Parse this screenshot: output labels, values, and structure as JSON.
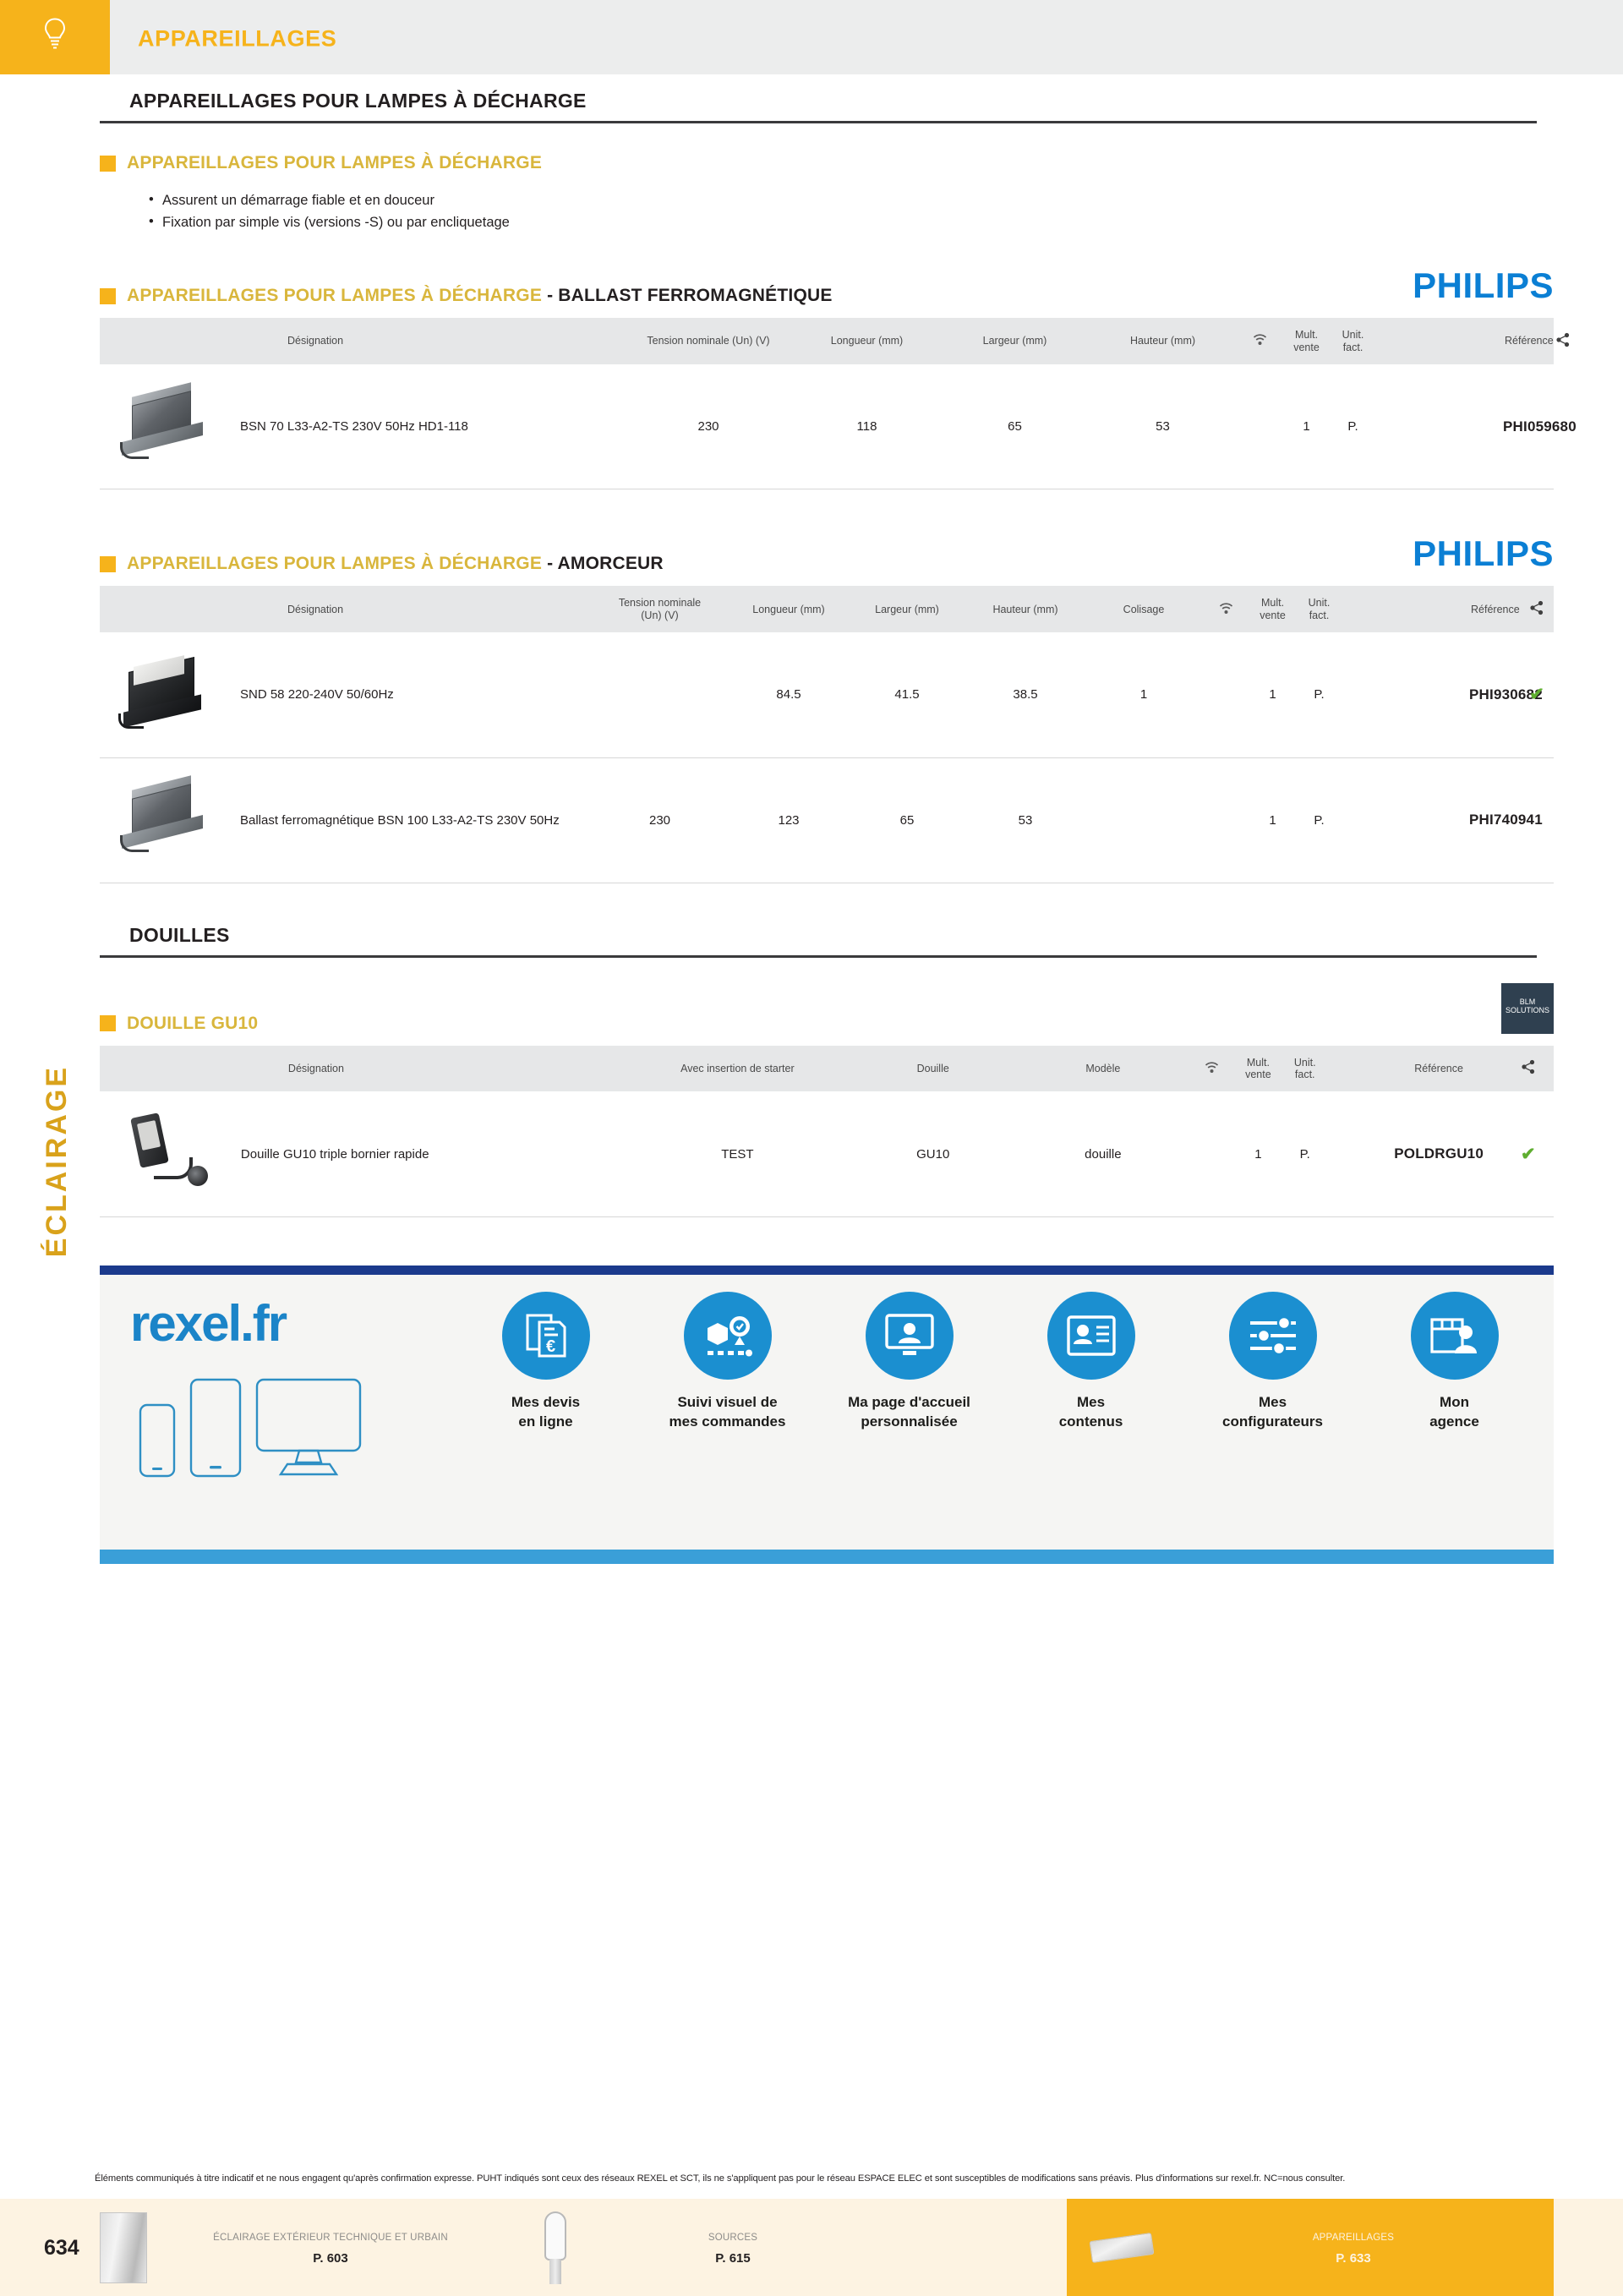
{
  "topbar": {
    "category": "APPAREILLAGES",
    "icon": "bulb-icon"
  },
  "rail_label": "ÉCLAIRAGE",
  "page_heading": "APPAREILLAGES POUR LAMPES À DÉCHARGE",
  "intro": {
    "title": "APPAREILLAGES POUR LAMPES À DÉCHARGE",
    "bullets": [
      "Assurent un démarrage fiable et en douceur",
      "Fixation par simple vis (versions -S) ou par encliquetage"
    ]
  },
  "sections": [
    {
      "title_yellow": "APPAREILLAGES POUR LAMPES À DÉCHARGE",
      "title_dark": " - BALLAST FERROMAGNÉTIQUE",
      "brand": "PHILIPS",
      "brand_type": "philips",
      "columns": [
        "Désignation",
        "Tension nominale (Un) (V)",
        "Longueur (mm)",
        "Largeur (mm)",
        "Hauteur (mm)",
        "wifi-icon",
        "Mult. vente",
        "Unit. fact.",
        "Référence",
        "share-icon"
      ],
      "rows": [
        {
          "thumb": "ballast",
          "designation": "BSN 70 L33-A2-TS 230V 50Hz HD1-118",
          "values": [
            "230",
            "118",
            "65",
            "53"
          ],
          "mult_vente": "1",
          "unit_fact": "P.",
          "reference": "PHI059680",
          "check": ""
        }
      ]
    },
    {
      "title_yellow": "APPAREILLAGES POUR LAMPES À DÉCHARGE",
      "title_dark": " - AMORCEUR",
      "brand": "PHILIPS",
      "brand_type": "philips",
      "columns": [
        "Désignation",
        "Tension nominale (Un) (V)",
        "Longueur (mm)",
        "Largeur (mm)",
        "Hauteur (mm)",
        "Colisage",
        "wifi-icon",
        "Mult. vente",
        "Unit. fact.",
        "Référence",
        "share-icon"
      ],
      "rows": [
        {
          "thumb": "starter",
          "designation": "SND 58 220-240V 50/60Hz",
          "values": [
            "",
            "84.5",
            "41.5",
            "38.5",
            "1"
          ],
          "mult_vente": "1",
          "unit_fact": "P.",
          "reference": "PHI930682",
          "check": "✔"
        },
        {
          "thumb": "ballast",
          "designation": "Ballast ferromagnétique BSN 100 L33-A2-TS 230V 50Hz",
          "values": [
            "230",
            "123",
            "65",
            "53",
            ""
          ],
          "mult_vente": "1",
          "unit_fact": "P.",
          "reference": "PHI740941",
          "check": ""
        }
      ]
    }
  ],
  "douilles": {
    "heading": "DOUILLES",
    "section": {
      "title_yellow": "DOUILLE GU10",
      "title_dark": "",
      "brand": "BLM SOLUTIONS",
      "brand_type": "box",
      "columns": [
        "Désignation",
        "Avec insertion de starter",
        "Douille",
        "Modèle",
        "wifi-icon",
        "Mult. vente",
        "Unit. fact.",
        "Référence",
        "share-icon"
      ],
      "rows": [
        {
          "thumb": "douille",
          "designation": "Douille GU10 triple bornier rapide",
          "values": [
            "TEST",
            "GU10",
            "douille"
          ],
          "mult_vente": "1",
          "unit_fact": "P.",
          "reference": "POLDRGU10",
          "check": "✔"
        }
      ]
    }
  },
  "promo": {
    "logo": "rexel.fr",
    "devices": [
      "phone-icon",
      "tablet-icon",
      "desktop-icon"
    ],
    "items": [
      {
        "icon": "invoice-euro-icon",
        "label_line1": "Mes devis",
        "label_line2": "en ligne"
      },
      {
        "icon": "package-tracking-icon",
        "label_line1": "Suivi visuel de",
        "label_line2": "mes commandes"
      },
      {
        "icon": "homepage-user-icon",
        "label_line1": "Ma page d'accueil",
        "label_line2": "personnalisée"
      },
      {
        "icon": "content-card-icon",
        "label_line1": "Mes",
        "label_line2": "contenus"
      },
      {
        "icon": "sliders-icon",
        "label_line1": "Mes",
        "label_line2": "configurateurs"
      },
      {
        "icon": "agency-person-icon",
        "label_line1": "Mon",
        "label_line2": "agence"
      }
    ],
    "colors": {
      "top_bar": "#1b3a8c",
      "bottom_bar": "#3a9fd8",
      "accent": "#1b8fd0"
    }
  },
  "footer": {
    "legal": "Éléments communiqués à titre indicatif et ne nous engagent qu'après confirmation expresse. PUHT indiqués sont ceux des réseaux REXEL et SCT, ils ne s'appliquent pas pour le réseau ESPACE ELEC et sont susceptibles de modifications sans préavis. Plus d'informations sur rexel.fr. NC=nous consulter.",
    "page_number": "634",
    "nav": [
      {
        "icon": "luminaire-icon",
        "title": "ÉCLAIRAGE EXTÉRIEUR TECHNIQUE ET URBAIN",
        "page": "P. 603",
        "active": false
      },
      {
        "icon": "lamp-icon",
        "title": "SOURCES",
        "page": "P. 615",
        "active": false
      },
      {
        "icon": "appareillage-icon",
        "title": "APPAREILLAGES",
        "page": "P. 633",
        "active": true
      }
    ]
  },
  "colors": {
    "yellow": "#f6b31b",
    "yellow_text": "#d9b63c",
    "dark": "#231f20",
    "philips_blue": "#0b7fd4",
    "check_green": "#5fae30"
  }
}
